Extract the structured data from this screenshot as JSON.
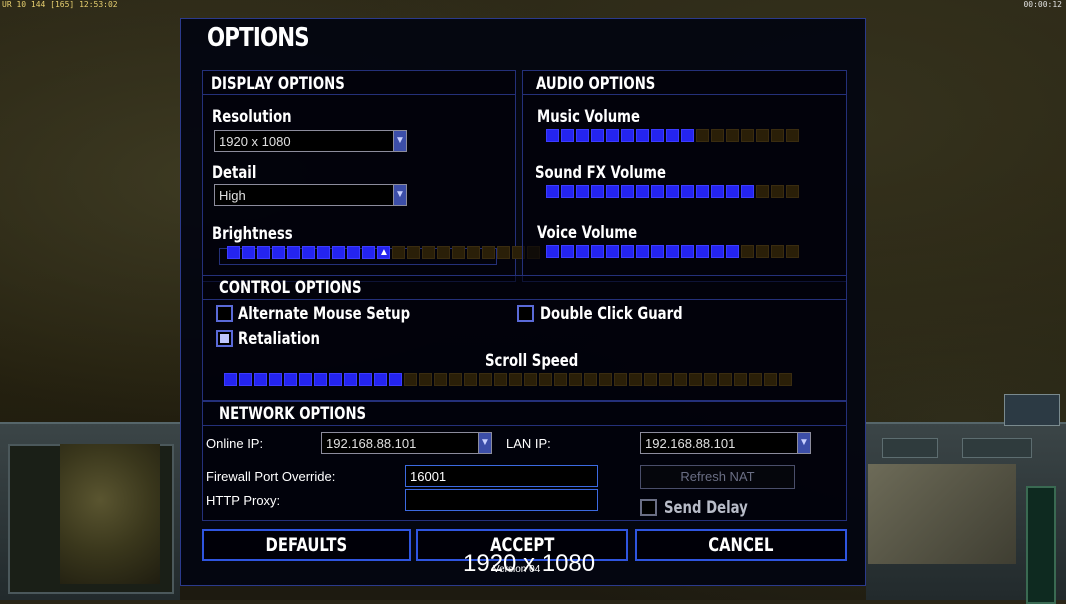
{
  "status": {
    "left": "UR 10 144 [165] 12:53:02",
    "right": "00:00:12"
  },
  "dialog": {
    "title": "OPTIONS"
  },
  "display": {
    "heading": "DISPLAY OPTIONS",
    "resolution_label": "Resolution",
    "resolution_value": "1920 x 1080",
    "detail_label": "Detail",
    "detail_value": "High",
    "brightness_label": "Brightness",
    "brightness_level": 0.51
  },
  "audio": {
    "heading": "AUDIO OPTIONS",
    "music_label": "Music Volume",
    "music_level": 0.6,
    "sfx_label": "Sound FX Volume",
    "sfx_level": 0.85,
    "voice_label": "Voice Volume",
    "voice_level": 0.75
  },
  "control": {
    "heading": "CONTROL OPTIONS",
    "alt_mouse_label": "Alternate Mouse Setup",
    "alt_mouse_checked": false,
    "retaliation_label": "Retaliation",
    "retaliation_checked": true,
    "double_click_label": "Double Click Guard",
    "double_click_checked": false,
    "scroll_label": "Scroll Speed",
    "scroll_level": 0.32
  },
  "network": {
    "heading": "NETWORK OPTIONS",
    "online_ip_label": "Online IP:",
    "online_ip_value": "192.168.88.101",
    "lan_ip_label": "LAN IP:",
    "lan_ip_value": "192.168.88.101",
    "firewall_label": "Firewall Port Override:",
    "firewall_value": "16001",
    "proxy_label": "HTTP Proxy:",
    "proxy_value": "",
    "refresh_label": "Refresh NAT",
    "send_delay_label": "Send Delay",
    "send_delay_checked": false
  },
  "buttons": {
    "defaults": "DEFAULTS",
    "accept": "ACCEPT",
    "cancel": "CANCEL"
  },
  "version": "Version 04",
  "overlay_resolution": "1920 x 1080",
  "colors": {
    "accent": "#2424f0",
    "border": "#2f55e0",
    "slider_off": "#2a1f08"
  }
}
